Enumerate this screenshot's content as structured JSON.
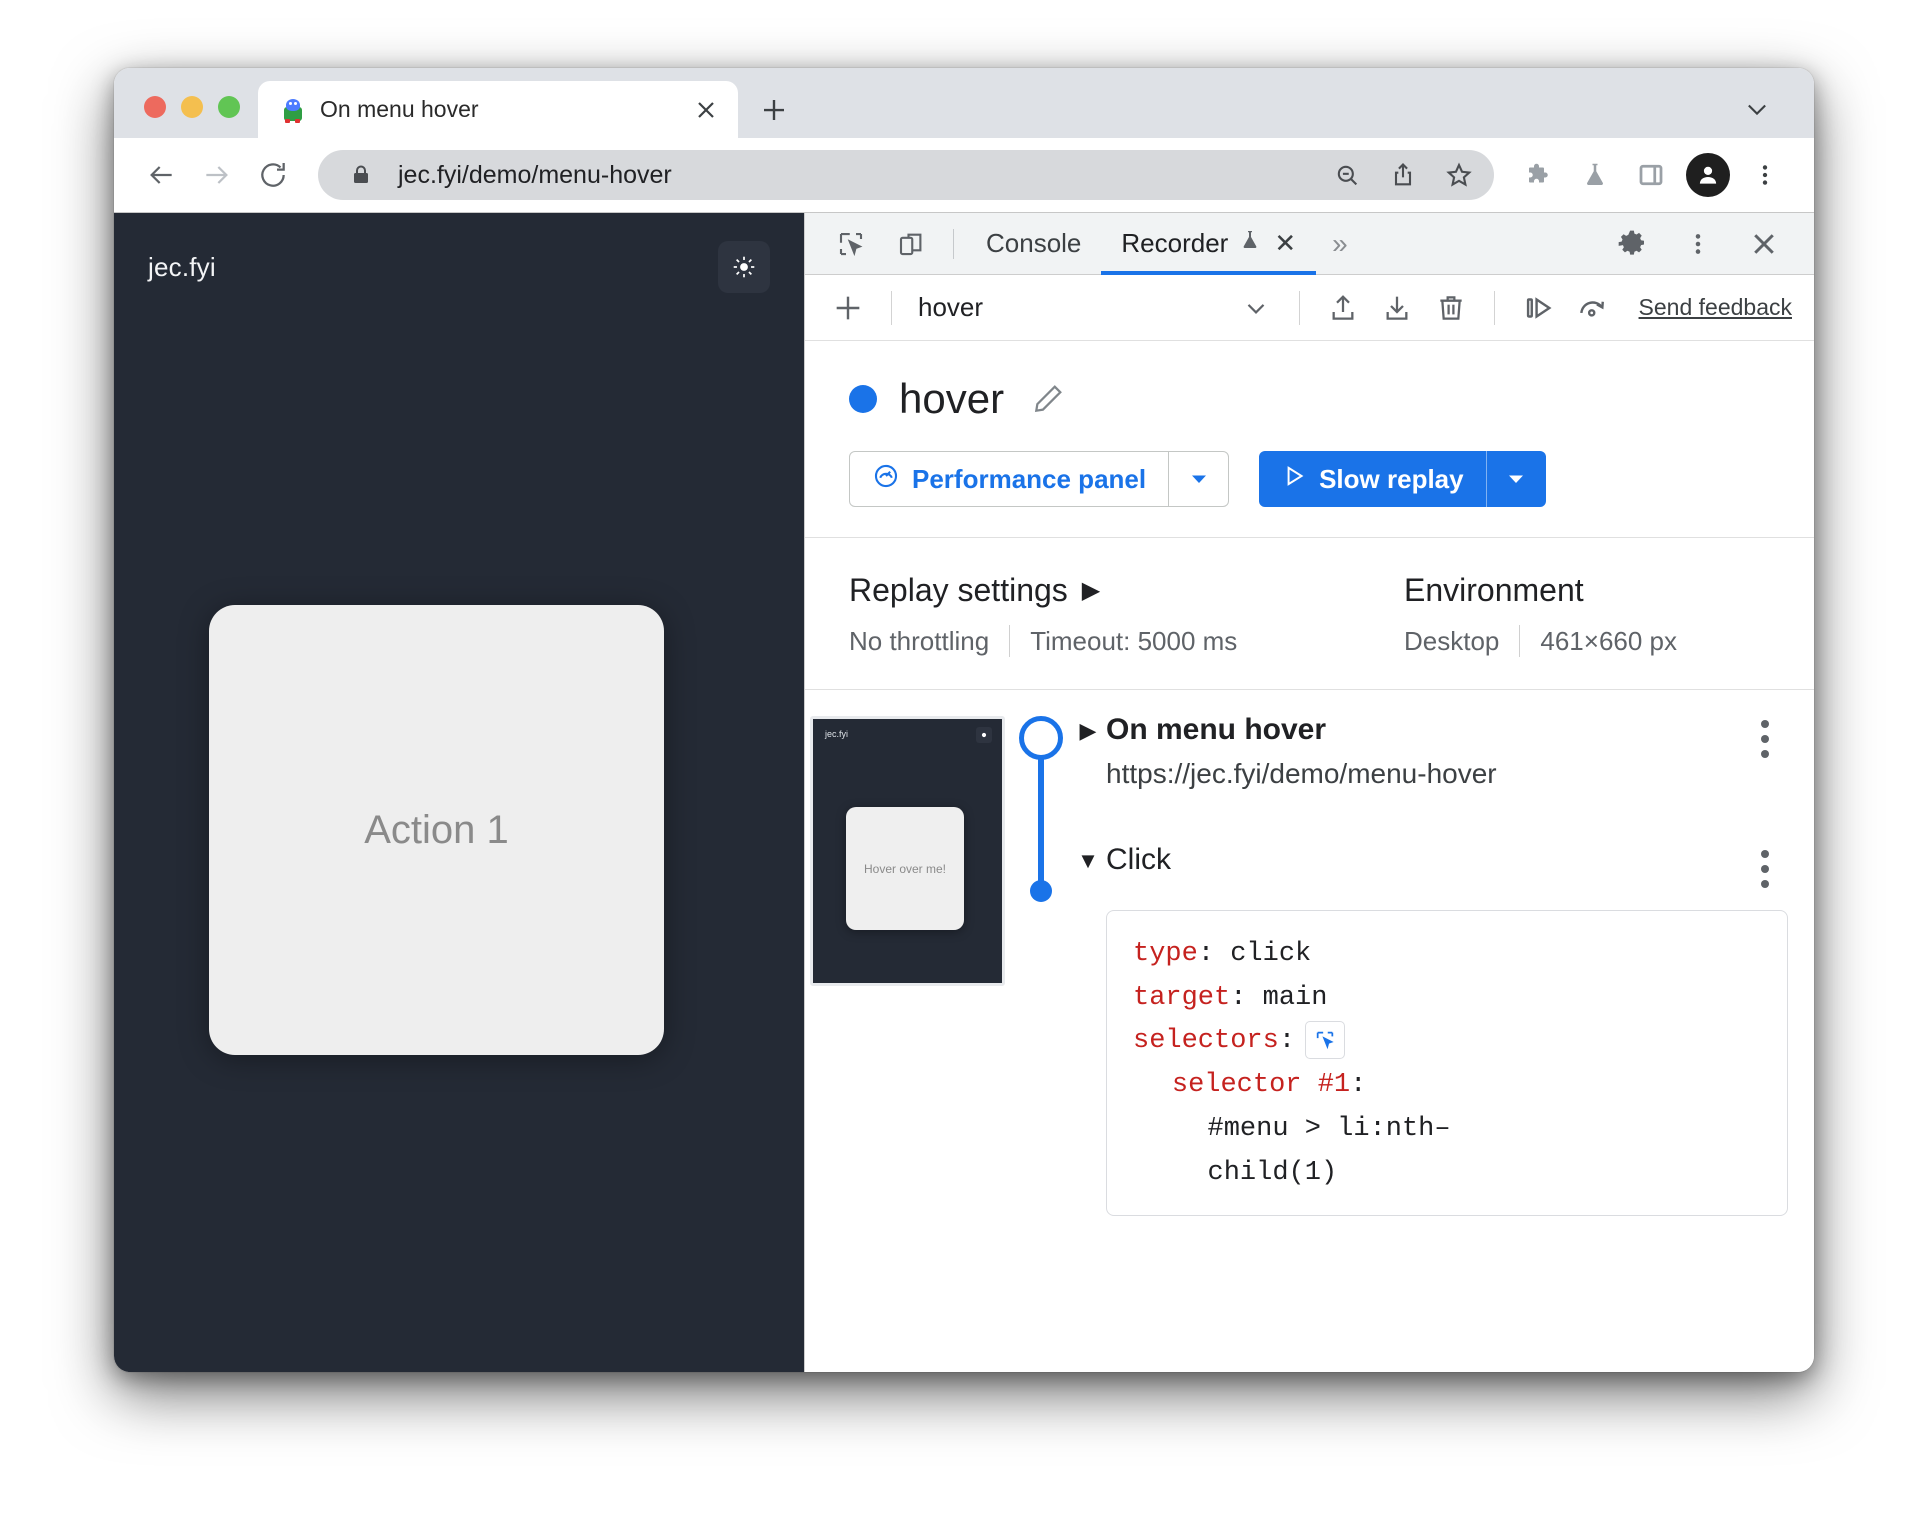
{
  "browser": {
    "tab": {
      "title": "On menu hover",
      "favicon": "puppeteer-favicon",
      "close_label": "✕"
    },
    "new_tab_label": "+",
    "omnibox": {
      "url": "jec.fyi/demo/menu-hover",
      "lock_icon": "lock-icon"
    },
    "toolbar_icons": [
      "back-arrow-icon",
      "forward-arrow-icon",
      "reload-icon",
      "zoom-out-icon",
      "share-icon",
      "bookmark-star-icon",
      "extensions-puzzle-icon",
      "labs-flask-icon",
      "side-panel-icon",
      "profile-avatar-icon",
      "chrome-menu-icon"
    ]
  },
  "page": {
    "brand": "jec.fyi",
    "theme_toggle_icon": "sun-icon",
    "action_card_label": "Action 1"
  },
  "devtools": {
    "tabs": [
      {
        "label": "Console",
        "active": false
      },
      {
        "label": "Recorder",
        "active": true,
        "experimental_icon": "flask-icon",
        "closeable": "✕"
      }
    ],
    "more_tabs_icon": "»",
    "left_icons": [
      "inspect-element-icon",
      "device-toolbar-icon"
    ],
    "right_icons": [
      "settings-gear-icon",
      "more-options-kebab-icon",
      "close-devtools-icon"
    ]
  },
  "recorder_toolbar": {
    "add_recording_icon": "plus-icon",
    "recording_name": "hover",
    "dropdown_icon": "chevron-down-icon",
    "export_icon": "upload-icon",
    "import_icon": "download-icon",
    "delete_icon": "trash-icon",
    "step_over_icon": "step-over-icon",
    "undo_icon": "replay-speed-icon",
    "feedback_label": "Send feedback"
  },
  "recording": {
    "status_dot_color": "#1a73e8",
    "title": "hover",
    "edit_icon": "pencil-icon",
    "performance_button": {
      "label": "Performance panel",
      "icon": "performance-gauge-icon",
      "dropdown_icon": "chevron-down-icon"
    },
    "replay_button": {
      "label": "Slow replay",
      "icon": "play-triangle-icon",
      "dropdown_icon": "chevron-down-icon"
    }
  },
  "replay_settings": {
    "title": "Replay settings",
    "expand_icon": "▶",
    "throttling": "No throttling",
    "timeout": "Timeout: 5000 ms"
  },
  "environment": {
    "title": "Environment",
    "device": "Desktop",
    "viewport": "461×660 px"
  },
  "thumbnail": {
    "brand": "jec.fyi",
    "theme_icon": "sun-icon",
    "card_label": "Hover over me!"
  },
  "steps": [
    {
      "caret": "▶",
      "title": "On menu hover",
      "url": "https://jec.fyi/demo/menu-hover",
      "kebab": "more-options-kebab-icon",
      "expanded": false
    },
    {
      "caret": "▼",
      "title": "Click",
      "kebab": "more-options-kebab-icon",
      "expanded": true
    }
  ],
  "step_details": {
    "type_key": "type",
    "type_value": ": click",
    "target_key": "target",
    "target_value": ": main",
    "selectors_key": "selectors",
    "selectors_value": ":",
    "picker_icon": "element-picker-icon",
    "selector1_key": "selector #1",
    "selector1_colon": ":",
    "selector1_value_line1": "#menu > li:nth–",
    "selector1_value_line2": "child(1)"
  },
  "colors": {
    "accent": "#1a73e8",
    "page_bg": "#242a35",
    "code_key": "#c5221f"
  }
}
